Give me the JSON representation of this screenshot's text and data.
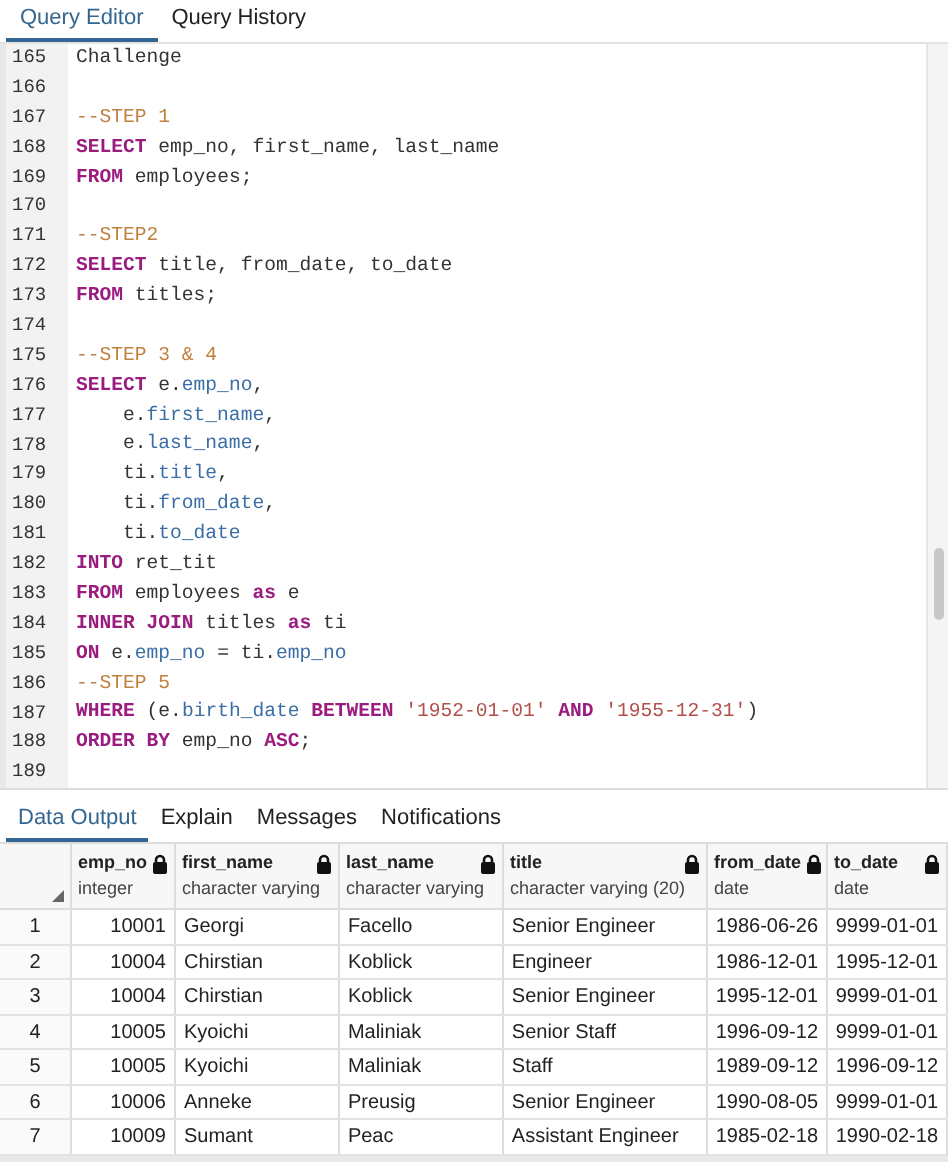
{
  "editor_tabs": [
    {
      "label": "Query Editor",
      "selected": true
    },
    {
      "label": "Query History",
      "selected": false
    }
  ],
  "code_lines": [
    {
      "number": "165",
      "tokens": [
        {
          "kind": "plain",
          "text": "Challenge"
        }
      ]
    },
    {
      "number": "166"
    },
    {
      "number": "167",
      "tokens": [
        {
          "kind": "comment",
          "text": "--STEP 1"
        }
      ]
    },
    {
      "number": "168",
      "tokens": [
        {
          "kind": "keyword",
          "text": "SELECT"
        },
        {
          "kind": "plain",
          "text": " emp_no, first_name, last_name"
        }
      ]
    },
    {
      "number": "169",
      "tokens": [
        {
          "kind": "keyword",
          "text": "FROM"
        },
        {
          "kind": "plain",
          "text": " employees;"
        }
      ]
    },
    {
      "number": "170"
    },
    {
      "number": "171",
      "tokens": [
        {
          "kind": "comment",
          "text": "--STEP2"
        }
      ]
    },
    {
      "number": "172",
      "tokens": [
        {
          "kind": "keyword",
          "text": "SELECT"
        },
        {
          "kind": "plain",
          "text": " title, from_date, to_date"
        }
      ]
    },
    {
      "number": "173",
      "tokens": [
        {
          "kind": "keyword",
          "text": "FROM"
        },
        {
          "kind": "plain",
          "text": " titles;"
        }
      ]
    },
    {
      "number": "174"
    },
    {
      "number": "175",
      "tokens": [
        {
          "kind": "comment",
          "text": "--STEP 3 & 4"
        }
      ]
    },
    {
      "number": "176",
      "tokens": [
        {
          "kind": "keyword",
          "text": "SELECT"
        },
        {
          "kind": "plain",
          "text": " e."
        },
        {
          "kind": "field",
          "text": "emp_no"
        },
        {
          "kind": "plain",
          "text": ","
        }
      ]
    },
    {
      "number": "177",
      "tokens": [
        {
          "kind": "plain",
          "text": "    e."
        },
        {
          "kind": "field",
          "text": "first_name"
        },
        {
          "kind": "plain",
          "text": ","
        }
      ]
    },
    {
      "number": "178",
      "tokens": [
        {
          "kind": "plain",
          "text": "    e."
        },
        {
          "kind": "field",
          "text": "last_name"
        },
        {
          "kind": "plain",
          "text": ","
        }
      ]
    },
    {
      "number": "179",
      "tokens": [
        {
          "kind": "plain",
          "text": "    ti."
        },
        {
          "kind": "field",
          "text": "title"
        },
        {
          "kind": "plain",
          "text": ","
        }
      ]
    },
    {
      "number": "180",
      "tokens": [
        {
          "kind": "plain",
          "text": "    ti."
        },
        {
          "kind": "field",
          "text": "from_date"
        },
        {
          "kind": "plain",
          "text": ","
        }
      ]
    },
    {
      "number": "181",
      "tokens": [
        {
          "kind": "plain",
          "text": "    ti."
        },
        {
          "kind": "field",
          "text": "to_date"
        }
      ]
    },
    {
      "number": "182",
      "tokens": [
        {
          "kind": "keyword",
          "text": "INTO"
        },
        {
          "kind": "plain",
          "text": " ret_tit"
        }
      ]
    },
    {
      "number": "183",
      "tokens": [
        {
          "kind": "keyword",
          "text": "FROM"
        },
        {
          "kind": "plain",
          "text": " employees "
        },
        {
          "kind": "keyword",
          "text": "as"
        },
        {
          "kind": "plain",
          "text": " e"
        }
      ]
    },
    {
      "number": "184",
      "tokens": [
        {
          "kind": "keyword",
          "text": "INNER JOIN"
        },
        {
          "kind": "plain",
          "text": " titles "
        },
        {
          "kind": "keyword",
          "text": "as"
        },
        {
          "kind": "plain",
          "text": " ti"
        }
      ]
    },
    {
      "number": "185",
      "tokens": [
        {
          "kind": "keyword",
          "text": "ON"
        },
        {
          "kind": "plain",
          "text": " e."
        },
        {
          "kind": "field",
          "text": "emp_no"
        },
        {
          "kind": "plain",
          "text": " = ti."
        },
        {
          "kind": "field",
          "text": "emp_no"
        }
      ]
    },
    {
      "number": "186",
      "tokens": [
        {
          "kind": "comment",
          "text": "--STEP 5"
        }
      ]
    },
    {
      "number": "187",
      "tokens": [
        {
          "kind": "keyword",
          "text": "WHERE"
        },
        {
          "kind": "plain",
          "text": " (e."
        },
        {
          "kind": "field",
          "text": "birth_date"
        },
        {
          "kind": "keyword",
          "text": " BETWEEN "
        },
        {
          "kind": "string",
          "text": "'1952-01-01'"
        },
        {
          "kind": "keyword",
          "text": " AND "
        },
        {
          "kind": "string",
          "text": "'1955-12-31'"
        },
        {
          "kind": "plain",
          "text": ")"
        }
      ]
    },
    {
      "number": "188",
      "tokens": [
        {
          "kind": "keyword",
          "text": "ORDER BY"
        },
        {
          "kind": "plain",
          "text": " emp_no "
        },
        {
          "kind": "keyword",
          "text": "ASC"
        },
        {
          "kind": "plain",
          "text": ";"
        }
      ]
    },
    {
      "number": "189"
    }
  ],
  "output_tabs": [
    {
      "label": "Data Output",
      "selected": true
    },
    {
      "label": "Explain",
      "selected": false
    },
    {
      "label": "Messages",
      "selected": false
    },
    {
      "label": "Notifications",
      "selected": false
    }
  ],
  "table": {
    "columns": [
      {
        "name": "emp_no",
        "type": "integer",
        "locked": true
      },
      {
        "name": "first_name",
        "type": "character varying",
        "locked": true
      },
      {
        "name": "last_name",
        "type": "character varying",
        "locked": true
      },
      {
        "name": "title",
        "type": "character varying (20)",
        "locked": true
      },
      {
        "name": "from_date",
        "type": "date",
        "locked": true
      },
      {
        "name": "to_date",
        "type": "date",
        "locked": true
      }
    ],
    "rows": [
      {
        "row_number": "1",
        "cells": [
          "10001",
          "Georgi",
          "Facello",
          "Senior Engineer",
          "1986-06-26",
          "9999-01-01"
        ]
      },
      {
        "row_number": "2",
        "cells": [
          "10004",
          "Chirstian",
          "Koblick",
          "Engineer",
          "1986-12-01",
          "1995-12-01"
        ]
      },
      {
        "row_number": "3",
        "cells": [
          "10004",
          "Chirstian",
          "Koblick",
          "Senior Engineer",
          "1995-12-01",
          "9999-01-01"
        ]
      },
      {
        "row_number": "4",
        "cells": [
          "10005",
          "Kyoichi",
          "Maliniak",
          "Senior Staff",
          "1996-09-12",
          "9999-01-01"
        ]
      },
      {
        "row_number": "5",
        "cells": [
          "10005",
          "Kyoichi",
          "Maliniak",
          "Staff",
          "1989-09-12",
          "1996-09-12"
        ]
      },
      {
        "row_number": "6",
        "cells": [
          "10006",
          "Anneke",
          "Preusig",
          "Senior Engineer",
          "1990-08-05",
          "9999-01-01"
        ]
      },
      {
        "row_number": "7",
        "cells": [
          "10009",
          "Sumant",
          "Peac",
          "Assistant Engineer",
          "1985-02-18",
          "1990-02-18"
        ]
      }
    ]
  }
}
